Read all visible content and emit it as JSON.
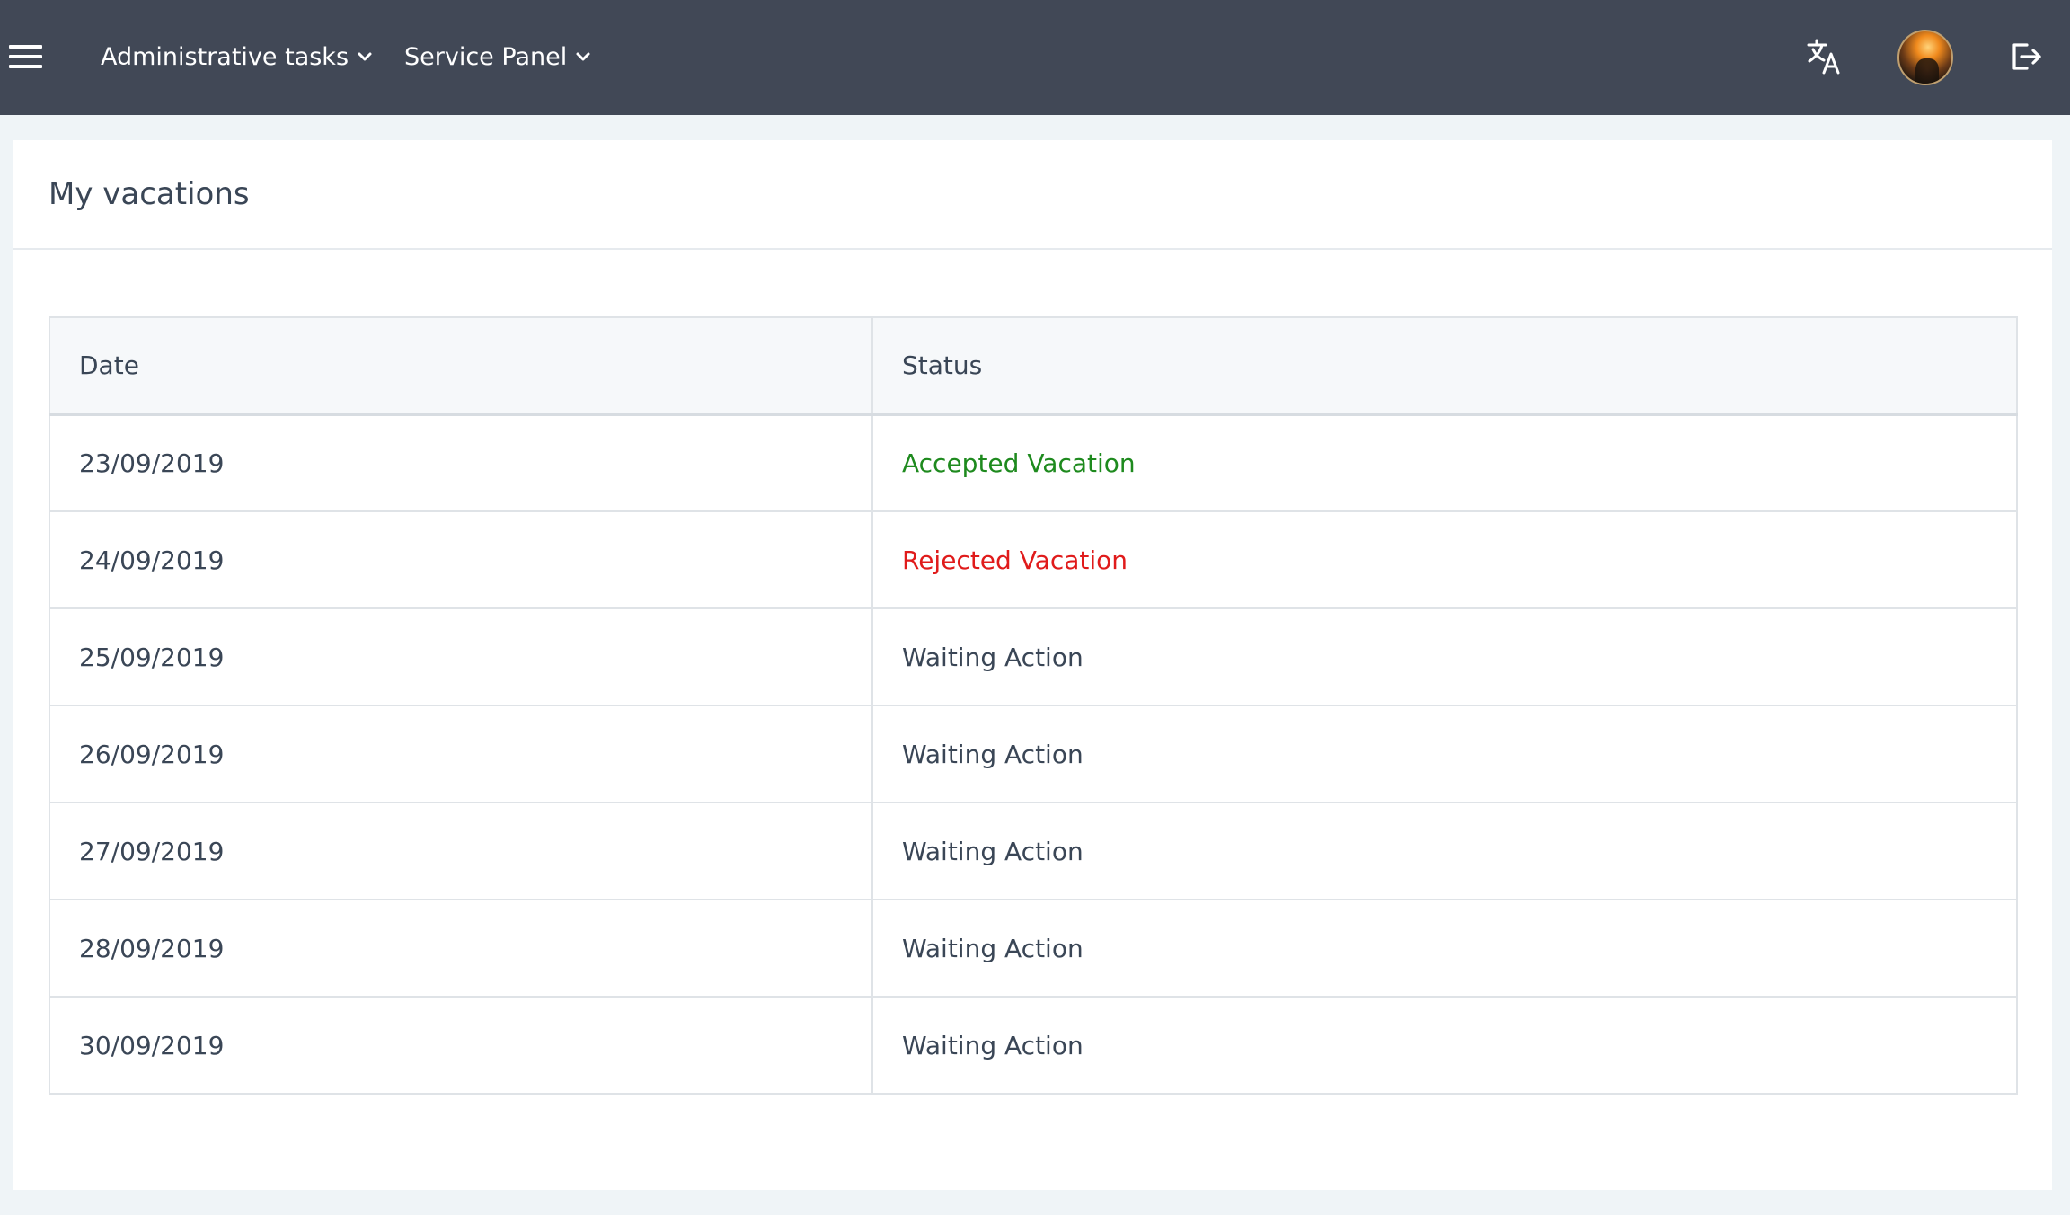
{
  "topbar": {
    "menu_icon": "hamburger-icon",
    "nav": [
      {
        "label": "Administrative tasks",
        "icon": "chevron-down-icon"
      },
      {
        "label": "Service Panel",
        "icon": "chevron-down-icon"
      }
    ],
    "translate_icon": "translate-icon",
    "avatar": "user-avatar",
    "logout_icon": "logout-icon",
    "background_color": "#414856"
  },
  "page": {
    "title": "My vacations"
  },
  "table": {
    "columns": [
      "Date",
      "Status"
    ],
    "rows": [
      {
        "date": "23/09/2019",
        "status": "Accepted Vacation",
        "status_color": "#1e8a1e"
      },
      {
        "date": "24/09/2019",
        "status": "Rejected Vacation",
        "status_color": "#e01b1b"
      },
      {
        "date": "25/09/2019",
        "status": "Waiting Action",
        "status_color": "#3a4656"
      },
      {
        "date": "26/09/2019",
        "status": "Waiting Action",
        "status_color": "#3a4656"
      },
      {
        "date": "27/09/2019",
        "status": "Waiting Action",
        "status_color": "#3a4656"
      },
      {
        "date": "28/09/2019",
        "status": "Waiting Action",
        "status_color": "#3a4656"
      },
      {
        "date": "30/09/2019",
        "status": "Waiting Action",
        "status_color": "#3a4656"
      }
    ]
  }
}
